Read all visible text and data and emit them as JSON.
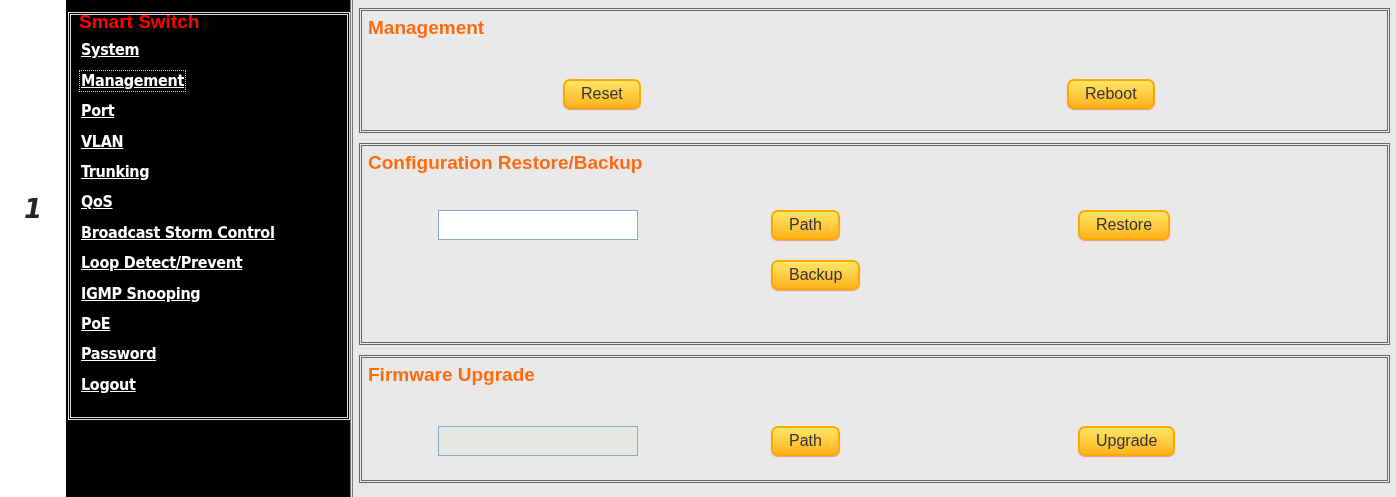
{
  "page_marker": "1",
  "sidebar": {
    "title": "Smart Switch",
    "items": [
      {
        "label": "System",
        "selected": false
      },
      {
        "label": "Management",
        "selected": true
      },
      {
        "label": "Port",
        "selected": false
      },
      {
        "label": "VLAN",
        "selected": false
      },
      {
        "label": "Trunking",
        "selected": false
      },
      {
        "label": "QoS",
        "selected": false
      },
      {
        "label": "Broadcast Storm Control",
        "selected": false
      },
      {
        "label": "Loop Detect/Prevent",
        "selected": false
      },
      {
        "label": "IGMP Snooping",
        "selected": false
      },
      {
        "label": "PoE",
        "selected": false
      },
      {
        "label": "Password",
        "selected": false
      },
      {
        "label": "Logout",
        "selected": false
      }
    ]
  },
  "sections": [
    {
      "title": "Management",
      "items": [
        {
          "kind": "button",
          "label": "Reset"
        },
        {
          "kind": "button",
          "label": "Reboot"
        }
      ]
    },
    {
      "title": "Configuration Restore/Backup",
      "items": [
        {
          "kind": "field",
          "disabled": false
        },
        {
          "kind": "button",
          "label": "Path"
        },
        {
          "kind": "button",
          "label": "Restore"
        },
        {
          "kind": "button",
          "label": "Backup"
        }
      ]
    },
    {
      "title": "Firmware Upgrade",
      "items": [
        {
          "kind": "field",
          "disabled": true
        },
        {
          "kind": "button",
          "label": "Path"
        },
        {
          "kind": "button",
          "label": "Upgrade"
        }
      ]
    }
  ]
}
